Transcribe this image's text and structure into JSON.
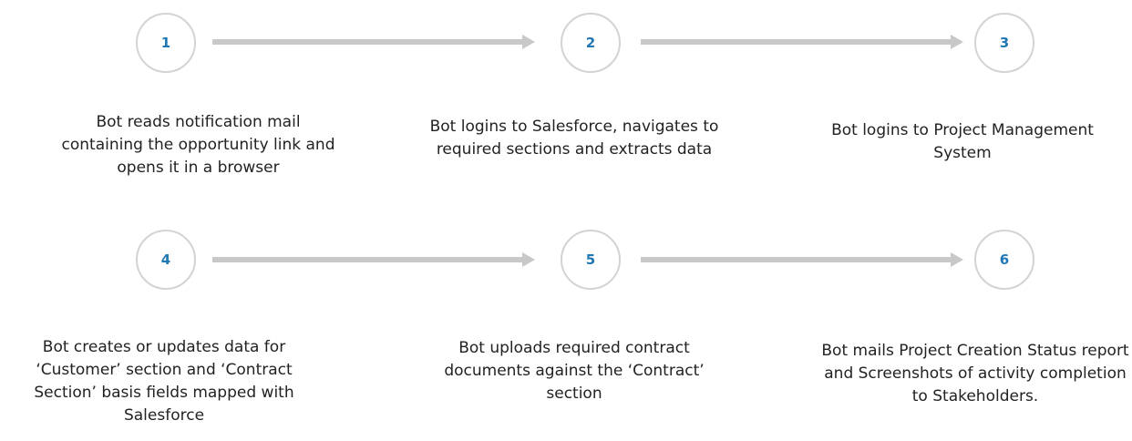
{
  "steps": [
    {
      "number": "1",
      "text": "Bot reads notification mail containing the opportunity link and opens it in a browser"
    },
    {
      "number": "2",
      "text": "Bot logins to Salesforce, navigates to required sections and extracts data"
    },
    {
      "number": "3",
      "text": "Bot logins to Project Management System"
    },
    {
      "number": "4",
      "text": "Bot creates or updates data for ‘Customer’ section and ‘Contract Section’ basis fields mapped with Salesforce"
    },
    {
      "number": "5",
      "text": "Bot uploads required contract documents against the ‘Contract’ section"
    },
    {
      "number": "6",
      "text": "Bot mails Project Creation Status report and Screenshots of activity completion to Stakeholders."
    }
  ],
  "colors": {
    "number": "#1f77b4",
    "circle_border": "#d3d3d3",
    "arrow": "#c8c8c8",
    "text": "#222222"
  }
}
